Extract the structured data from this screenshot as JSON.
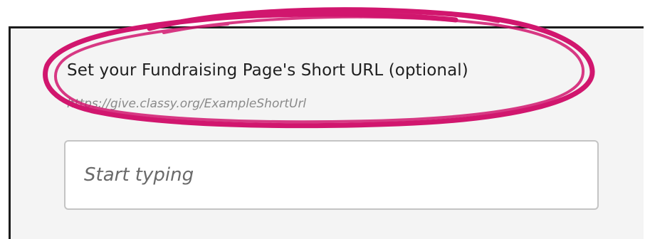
{
  "form": {
    "short_url_label": "Set your Fundraising Page's Short URL (optional)",
    "short_url_hint": "https://give.classy.org/ExampleShortUrl",
    "short_url_placeholder": "Start typing"
  },
  "colors": {
    "panel_background": "#f4f4f4",
    "panel_border": "#1c1c1c",
    "annotation_marker": "#d1166e"
  },
  "annotation": {
    "shape": "hand-drawn ellipse",
    "target": "short-url-label"
  }
}
